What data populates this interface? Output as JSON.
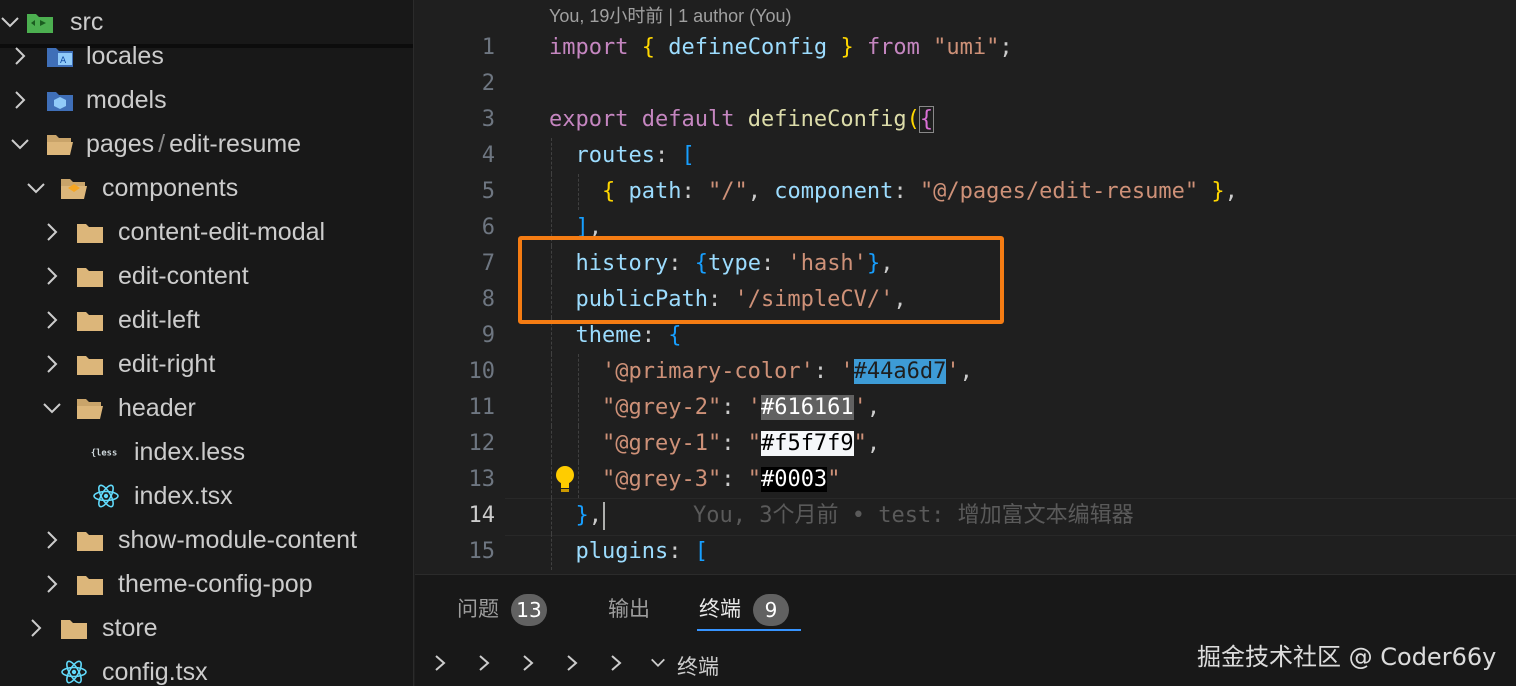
{
  "explorer": {
    "root": "src",
    "items": [
      {
        "label": "locales"
      },
      {
        "label": "models"
      },
      {
        "label_a": "pages",
        "label_b": "edit-resume"
      },
      {
        "label": "components"
      },
      {
        "label": "content-edit-modal"
      },
      {
        "label": "edit-content"
      },
      {
        "label": "edit-left"
      },
      {
        "label": "edit-right"
      },
      {
        "label": "header"
      },
      {
        "label": "index.less"
      },
      {
        "label": "index.tsx"
      },
      {
        "label": "show-module-content"
      },
      {
        "label": "theme-config-pop"
      },
      {
        "label": "store"
      },
      {
        "label": "config.tsx"
      }
    ]
  },
  "editor": {
    "blame_header": "You, 19小时前 | 1 author (You)",
    "active_line": 14,
    "inline_blame": "You, 3个月前 • test: 增加富文本编辑器",
    "line_numbers": [
      "1",
      "2",
      "3",
      "4",
      "5",
      "6",
      "7",
      "8",
      "9",
      "10",
      "11",
      "12",
      "13",
      "14",
      "15"
    ],
    "code": {
      "l1": {
        "import": "import",
        "ob": "{",
        "name": "defineConfig",
        "cb": "}",
        "from": "from",
        "mod": "\"umi\"",
        "semi": ";"
      },
      "l3": {
        "export": "export",
        "default": "default",
        "fn": "defineConfig",
        "op": "(",
        "ob": "{"
      },
      "l4": {
        "key": "routes",
        "colon": ":",
        "ob": "["
      },
      "l5": {
        "ob": "{",
        "k1": "path",
        "c1": ":",
        "v1": "\"/\"",
        "comma": ",",
        "k2": "component",
        "c2": ":",
        "v2": "\"@/pages/edit-resume\"",
        "cb": "}",
        "end": ","
      },
      "l6": {
        "cb": "]",
        "end": ","
      },
      "l7": {
        "key": "history",
        "colon": ":",
        "ob": "{",
        "k": "type",
        "c": ":",
        "v": "'hash'",
        "cb": "}",
        "end": ","
      },
      "l8": {
        "key": "publicPath",
        "colon": ":",
        "v": "'/simpleCV/'",
        "end": ","
      },
      "l9": {
        "key": "theme",
        "colon": ":",
        "ob": "{"
      },
      "l10": {
        "q1": "'@primary-color'",
        "colon": ":",
        "q2a": "'",
        "color": "#44a6d7",
        "q2b": "'",
        "end": ","
      },
      "l11": {
        "q1": "\"@grey-2\"",
        "colon": ":",
        "q2a": "'",
        "color": "#616161",
        "q2b": "'",
        "end": ","
      },
      "l12": {
        "q1": "\"@grey-1\"",
        "colon": ":",
        "q2a": "\"",
        "color": "#f5f7f9",
        "q2b": "\"",
        "end": ","
      },
      "l13": {
        "q1": "\"@grey-3\"",
        "colon": ":",
        "q2a": "\"",
        "color": "#0003",
        "q2b": "\""
      },
      "l14": {
        "cb": "}",
        "end": ","
      },
      "l15": {
        "key": "plugins",
        "colon": ":",
        "ob": "["
      }
    }
  },
  "panel": {
    "tabs": [
      {
        "label": "问题",
        "badge": "13"
      },
      {
        "label": "输出"
      },
      {
        "label": "终端",
        "badge": "9"
      }
    ],
    "terminal_label": "终端",
    "watermark": "掘金技术社区 @ Coder66y"
  },
  "colors": {
    "accent": "#3794ff",
    "highlight_box": "#f57c13",
    "folder": "#dcb67a",
    "react": "#61dafb"
  }
}
